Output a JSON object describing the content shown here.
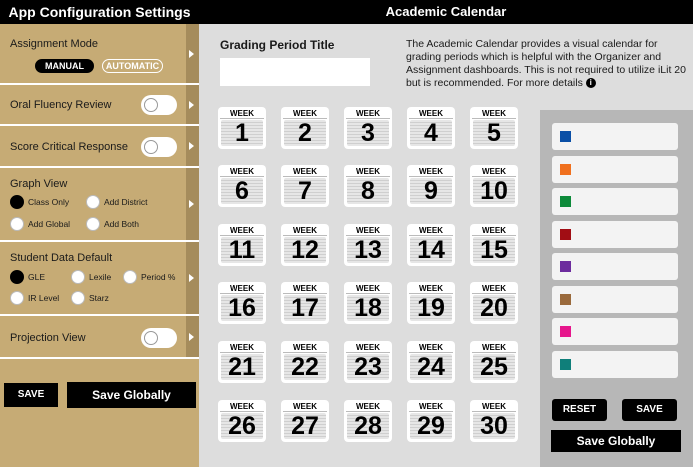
{
  "left": {
    "title": "App Configuration Settings",
    "assignment_mode": {
      "label": "Assignment Mode",
      "manual": "MANUAL",
      "automatic": "AUTOMATIC"
    },
    "oral_fluency": {
      "label": "Oral Fluency Review"
    },
    "score_critical": {
      "label": "Score Critical Response"
    },
    "graph_view": {
      "label": "Graph View",
      "options": [
        "Class Only",
        "Add District",
        "Add Global",
        "Add Both"
      ]
    },
    "student_data": {
      "label": "Student Data Default",
      "options": [
        "GLE",
        "Lexile",
        "Period %",
        "IR Level",
        "Starz"
      ]
    },
    "projection": {
      "label": "Projection View"
    },
    "save": "SAVE",
    "save_globally": "Save Globally"
  },
  "center": {
    "title": "Academic Calendar",
    "grading_title_label": "Grading Period Title",
    "grading_title_value": "",
    "description": "The Academic Calendar provides a visual calendar for grading periods which is helpful with the Organizer and Assignment dashboards. This is not required to utilize iLit 20 but is recommended. For more details",
    "info_icon": "i",
    "week_label": "WEEK",
    "weeks": [
      "1",
      "2",
      "3",
      "4",
      "5",
      "6",
      "7",
      "8",
      "9",
      "10",
      "11",
      "12",
      "13",
      "14",
      "15",
      "16",
      "17",
      "18",
      "19",
      "20",
      "21",
      "22",
      "23",
      "24",
      "25",
      "26",
      "27",
      "28",
      "29",
      "30"
    ]
  },
  "right": {
    "swatches": [
      "#0a4fa6",
      "#f0701e",
      "#0d8a3a",
      "#a10d14",
      "#6d2c9e",
      "#9a6a3c",
      "#e6168c",
      "#0f7f7a"
    ],
    "reset": "RESET",
    "save": "SAVE",
    "save_globally": "Save Globally"
  }
}
